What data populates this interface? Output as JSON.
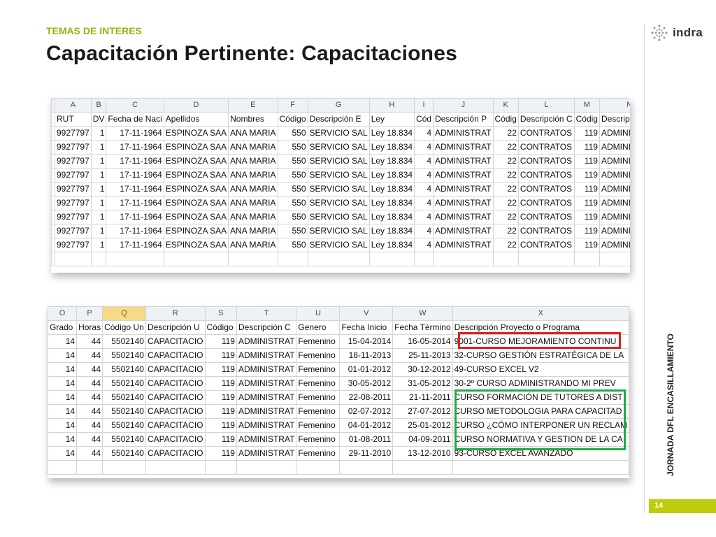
{
  "header": {
    "kicker": "TEMAS DE INTERES",
    "title": "Capacitación Pertinente: Capacitaciones"
  },
  "brand": {
    "logo_text": "indra",
    "accent_color": "#bfcc0d"
  },
  "side_label": "JORNADA DFL ENCASILLAMIENTO",
  "page_number": "14",
  "sheet1": {
    "col_letters": [
      "A",
      "B",
      "C",
      "D",
      "E",
      "F",
      "G",
      "H",
      "I",
      "J",
      "K",
      "L",
      "M",
      "N"
    ],
    "headers": [
      "RUT",
      "DV",
      "Fecha de Naci",
      "Apellidos",
      "Nombres",
      "Código",
      "Descripción E",
      "Ley",
      "Cód",
      "Descripción P",
      "Códig",
      "Descripción C",
      "Códig",
      "Descripción F"
    ],
    "rows": [
      [
        "9927797",
        "1",
        "17-11-1964",
        "ESPINOZA SAA",
        "ANA MARIA",
        "550",
        "SERVICIO SAL",
        "Ley 18.834",
        "4",
        "ADMINISTRAT",
        "22",
        "CONTRATOS",
        "119",
        "ADMINISTRAT"
      ],
      [
        "9927797",
        "1",
        "17-11-1964",
        "ESPINOZA SAA",
        "ANA MARIA",
        "550",
        "SERVICIO SAL",
        "Ley 18.834",
        "4",
        "ADMINISTRAT",
        "22",
        "CONTRATOS",
        "119",
        "ADMINISTRAT"
      ],
      [
        "9927797",
        "1",
        "17-11-1964",
        "ESPINOZA SAA",
        "ANA MARIA",
        "550",
        "SERVICIO SAL",
        "Ley 18.834",
        "4",
        "ADMINISTRAT",
        "22",
        "CONTRATOS",
        "119",
        "ADMINISTRAT"
      ],
      [
        "9927797",
        "1",
        "17-11-1964",
        "ESPINOZA SAA",
        "ANA MARIA",
        "550",
        "SERVICIO SAL",
        "Ley 18.834",
        "4",
        "ADMINISTRAT",
        "22",
        "CONTRATOS",
        "119",
        "ADMINISTRAT"
      ],
      [
        "9927797",
        "1",
        "17-11-1964",
        "ESPINOZA SAA",
        "ANA MARIA",
        "550",
        "SERVICIO SAL",
        "Ley 18.834",
        "4",
        "ADMINISTRAT",
        "22",
        "CONTRATOS",
        "119",
        "ADMINISTRAT"
      ],
      [
        "9927797",
        "1",
        "17-11-1964",
        "ESPINOZA SAA",
        "ANA MARIA",
        "550",
        "SERVICIO SAL",
        "Ley 18.834",
        "4",
        "ADMINISTRAT",
        "22",
        "CONTRATOS",
        "119",
        "ADMINISTRAT"
      ],
      [
        "9927797",
        "1",
        "17-11-1964",
        "ESPINOZA SAA",
        "ANA MARIA",
        "550",
        "SERVICIO SAL",
        "Ley 18.834",
        "4",
        "ADMINISTRAT",
        "22",
        "CONTRATOS",
        "119",
        "ADMINISTRAT"
      ],
      [
        "9927797",
        "1",
        "17-11-1964",
        "ESPINOZA SAA",
        "ANA MARIA",
        "550",
        "SERVICIO SAL",
        "Ley 18.834",
        "4",
        "ADMINISTRAT",
        "22",
        "CONTRATOS",
        "119",
        "ADMINISTRAT"
      ],
      [
        "9927797",
        "1",
        "17-11-1964",
        "ESPINOZA SAA",
        "ANA MARIA",
        "550",
        "SERVICIO SAL",
        "Ley 18.834",
        "4",
        "ADMINISTRAT",
        "22",
        "CONTRATOS",
        "119",
        "ADMINISTRAT"
      ]
    ]
  },
  "sheet2": {
    "col_letters": [
      "O",
      "P",
      "Q",
      "R",
      "S",
      "T",
      "U",
      "V",
      "W",
      "X"
    ],
    "selected_col": "Q",
    "headers": [
      "Grado",
      "Horas",
      "Código Un",
      "Descripción U",
      "Código",
      "Descripción C",
      "Genero",
      "Fecha Inicio",
      "Fecha Término",
      "Descripción Proyecto o Programa"
    ],
    "rows": [
      [
        "14",
        "44",
        "5502140",
        "CAPACITACIO",
        "119",
        "ADMINISTRAT",
        "Femenino",
        "15-04-2014",
        "16-05-2014",
        "9001-CURSO MEJORAMIENTO CONTINU"
      ],
      [
        "14",
        "44",
        "5502140",
        "CAPACITACIO",
        "119",
        "ADMINISTRAT",
        "Femenino",
        "18-11-2013",
        "25-11-2013",
        "32-CURSO GESTIÓN ESTRATÉGICA DE LA"
      ],
      [
        "14",
        "44",
        "5502140",
        "CAPACITACIO",
        "119",
        "ADMINISTRAT",
        "Femenino",
        "01-01-2012",
        "30-12-2012",
        "49-CURSO EXCEL V2"
      ],
      [
        "14",
        "44",
        "5502140",
        "CAPACITACIO",
        "119",
        "ADMINISTRAT",
        "Femenino",
        "30-05-2012",
        "31-05-2012",
        "30-2º CURSO ADMINISTRANDO MI PREV"
      ],
      [
        "14",
        "44",
        "5502140",
        "CAPACITACIO",
        "119",
        "ADMINISTRAT",
        "Femenino",
        "22-08-2011",
        "21-11-2011",
        "CURSO FORMACIÓN DE TUTORES A DIST"
      ],
      [
        "14",
        "44",
        "5502140",
        "CAPACITACIO",
        "119",
        "ADMINISTRAT",
        "Femenino",
        "02-07-2012",
        "27-07-2012",
        "CURSO METODOLOGIA PARA CAPACITAD"
      ],
      [
        "14",
        "44",
        "5502140",
        "CAPACITACIO",
        "119",
        "ADMINISTRAT",
        "Femenino",
        "04-01-2012",
        "25-01-2012",
        "CURSO ¿CÓMO INTERPONER UN RECLAM"
      ],
      [
        "14",
        "44",
        "5502140",
        "CAPACITACIO",
        "119",
        "ADMINISTRAT",
        "Femenino",
        "01-08-2011",
        "04-09-2011",
        "CURSO NORMATIVA Y GESTION DE LA CA"
      ],
      [
        "14",
        "44",
        "5502140",
        "CAPACITACIO",
        "119",
        "ADMINISTRAT",
        "Femenino",
        "29-11-2010",
        "13-12-2010",
        "93-CURSO EXCEL AVANZADO"
      ]
    ]
  },
  "highlights": {
    "red_color": "#e02020",
    "green_color": "#1faa44"
  }
}
